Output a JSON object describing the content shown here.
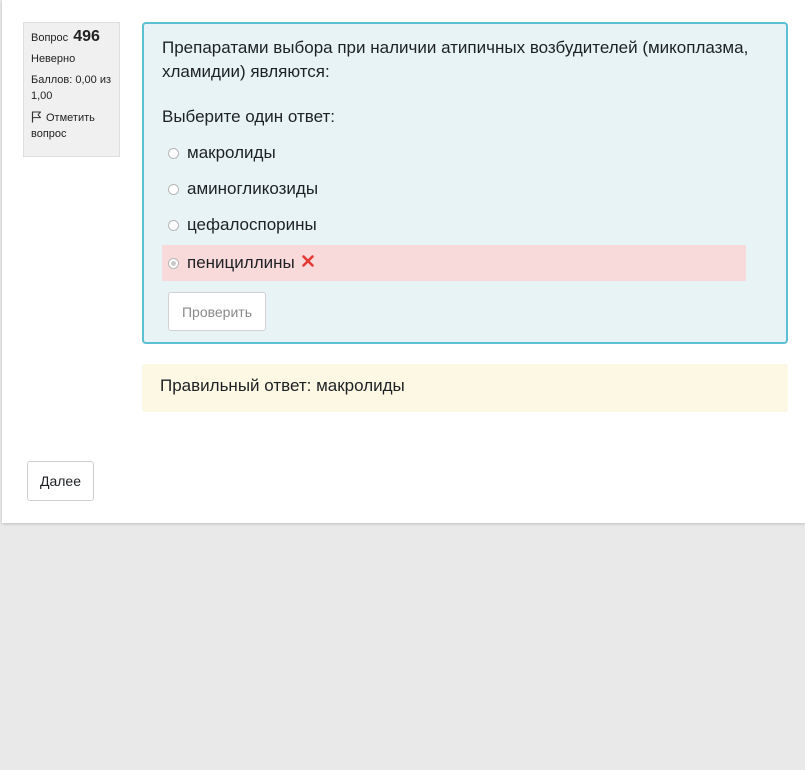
{
  "question_info": {
    "label": "Вопрос",
    "number": "496",
    "state": "Неверно",
    "grade": "Баллов: 0,00 из 1,00",
    "flag_label": "Отметить вопрос"
  },
  "question": {
    "text": "Препаратами выбора при наличии атипичных возбудителей (микоплазма, хламидии) являются:",
    "prompt": "Выберите один ответ:",
    "options": [
      {
        "label": "макролиды",
        "selected": false,
        "state": "neutral"
      },
      {
        "label": "аминогликозиды",
        "selected": false,
        "state": "neutral"
      },
      {
        "label": "цефалоспорины",
        "selected": false,
        "state": "neutral"
      },
      {
        "label": "пенициллины",
        "selected": true,
        "state": "incorrect"
      }
    ],
    "check_button": "Проверить"
  },
  "feedback": {
    "right_answer": "Правильный ответ: макролиды"
  },
  "navigation": {
    "next_button": "Далее"
  },
  "colors": {
    "formulation_bg": "#e7f3f5",
    "formulation_border": "#5bc0d3",
    "incorrect_bg": "#f8dada",
    "feedback_bg": "#fcf8e3",
    "incorrect_icon": "#e53935"
  },
  "icons": {
    "flag": "flag-icon",
    "incorrect": "cross-icon"
  }
}
